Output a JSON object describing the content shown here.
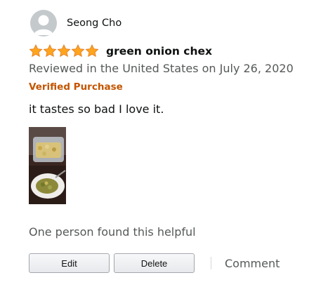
{
  "reviewer": {
    "name": "Seong Cho",
    "avatar_icon": "default-user-avatar"
  },
  "rating": {
    "stars": 5,
    "max": 5,
    "star_color": "#ffa41c"
  },
  "review": {
    "title": "green onion chex",
    "date_line": "Reviewed in the United States on July 26, 2020",
    "verified_label": "Verified Purchase",
    "body": "it tastes so bad I love it."
  },
  "helpful_text": "One person found this helpful",
  "actions": {
    "edit_label": "Edit",
    "delete_label": "Delete",
    "comment_label": "Comment"
  },
  "colors": {
    "verified": "#c45500",
    "secondary_text": "#565959"
  }
}
